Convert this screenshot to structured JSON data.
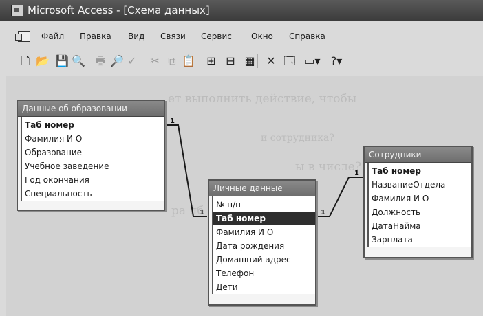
{
  "window": {
    "title": "Microsoft Access - [Схема данных]"
  },
  "menu": [
    "Файл",
    "Правка",
    "Вид",
    "Связи",
    "Сервис",
    "Окно",
    "Справка"
  ],
  "toolbar": [
    {
      "name": "new-icon",
      "glyph": "🗋",
      "dim": false
    },
    {
      "name": "open-icon",
      "glyph": "📂",
      "dim": false
    },
    {
      "name": "save-icon",
      "glyph": "💾",
      "dim": false
    },
    {
      "name": "search-icon",
      "glyph": "🔍",
      "dim": false
    },
    {
      "name": "print-icon",
      "glyph": "🖶",
      "dim": true
    },
    {
      "name": "preview-icon",
      "glyph": "🔎",
      "dim": true
    },
    {
      "name": "spelling-icon",
      "glyph": "✓",
      "dim": true
    },
    {
      "name": "cut-icon",
      "glyph": "✂",
      "dim": true
    },
    {
      "name": "copy-icon",
      "glyph": "⧉",
      "dim": true
    },
    {
      "name": "paste-icon",
      "glyph": "📋",
      "dim": true
    },
    {
      "name": "show-table-icon",
      "glyph": "⊞",
      "dim": false
    },
    {
      "name": "direct-relationships-icon",
      "glyph": "⊟",
      "dim": false
    },
    {
      "name": "all-relationships-icon",
      "glyph": "▦",
      "dim": false
    },
    {
      "name": "delete-icon",
      "glyph": "✕",
      "dim": false
    },
    {
      "name": "database-window-icon",
      "glyph": "🗔",
      "dim": false
    },
    {
      "name": "new-object-icon",
      "glyph": "▭▾",
      "dim": false
    },
    {
      "name": "help-icon",
      "glyph": "?▾",
      "dim": false
    }
  ],
  "background_text": [
    "ет выполнить действие, чтобы",
    "и сотрудника?",
    "ы в числе?",
    "ра лб ой данноото"
  ],
  "tables": {
    "education": {
      "title": "Данные об образовании",
      "fields": [
        "Таб номер",
        "Фамилия И О",
        "Образование",
        "Учебное заведение",
        "Год окончания",
        "Специальность"
      ]
    },
    "personal": {
      "title": "Личные данные",
      "fields": [
        "№ п/п",
        "Таб номер",
        "Фамилия И О",
        "Дата рождения",
        "Домашний адрес",
        "Телефон",
        "Дети"
      ]
    },
    "employees": {
      "title": "Сотрудники",
      "fields": [
        "Таб номер",
        "НазваниеОтдела",
        "Фамилия И О",
        "Должность",
        "ДатаНайма",
        "Зарплата"
      ]
    }
  },
  "relationships": [
    {
      "from": "Данные об образовании.Таб номер",
      "to": "Личные данные.Таб номер",
      "from_label": "1",
      "to_label": "1"
    },
    {
      "from": "Личные данные.Таб номер",
      "to": "Сотрудники.Таб номер",
      "from_label": "1",
      "to_label": "1"
    }
  ]
}
